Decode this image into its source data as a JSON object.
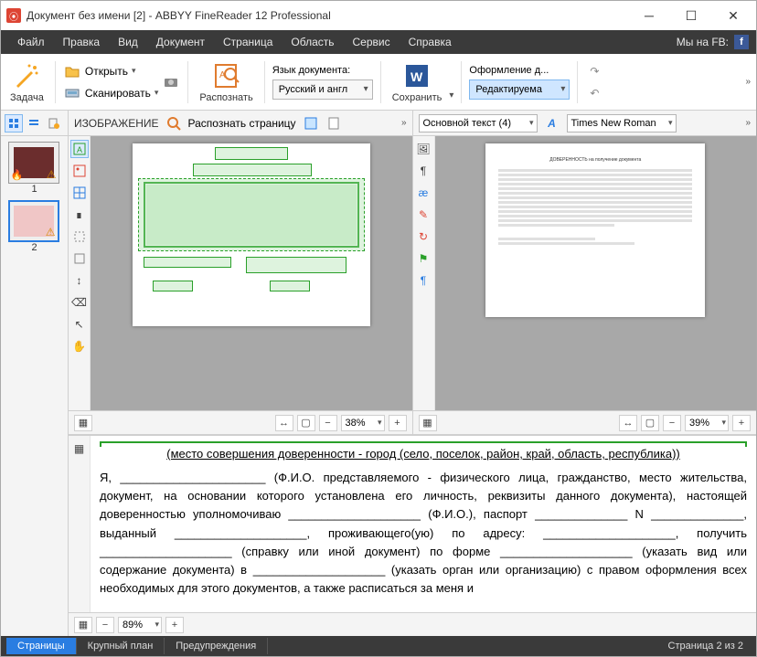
{
  "window": {
    "title": "Документ без имени [2] - ABBYY FineReader 12 Professional"
  },
  "menu": {
    "file": "Файл",
    "edit": "Правка",
    "view": "Вид",
    "document": "Документ",
    "page": "Страница",
    "area": "Область",
    "service": "Сервис",
    "help": "Справка",
    "fb": "Мы на FB:"
  },
  "toolbar": {
    "task": "Задача",
    "open": "Открыть",
    "scan": "Сканировать",
    "recognize": "Распознать",
    "lang_label": "Язык документа:",
    "lang_value": "Русский и англ",
    "save": "Сохранить",
    "layout_label": "Оформление д...",
    "layout_value": "Редактируема"
  },
  "image_pane": {
    "title": "ИЗОБРАЖЕНИЕ",
    "recognize_page": "Распознать страницу",
    "zoom": "38%"
  },
  "text_pane": {
    "style_value": "Основной текст (4)",
    "font_value": "Times New Roman",
    "zoom": "39%"
  },
  "pages": {
    "p1": "1",
    "p2": "2"
  },
  "detail": {
    "zoom": "89%",
    "line_place": "(место совершения доверенности - город (село, поселок, район, край, область, республика))",
    "body": "Я, ______________________ (Ф.И.О. представляемого - физического лица, гражданство, место жительства, документ, на основании которого установлена его личность, реквизиты данного документа), настоящей доверенностью уполномочиваю ____________________ (Ф.И.О.), паспорт ______________ N ______________, выданный ____________________, проживающего(ую) по адресу: ____________________, получить ____________________ (справку или иной документ) по форме ____________________ (указать вид или содержание документа) в ____________________ (указать орган или организацию) с правом оформления всех необходимых для этого документов, а также расписаться за меня и"
  },
  "status": {
    "pages": "Страницы",
    "closeup": "Крупный план",
    "warnings": "Предупреждения",
    "page_of": "Страница 2 из 2"
  }
}
